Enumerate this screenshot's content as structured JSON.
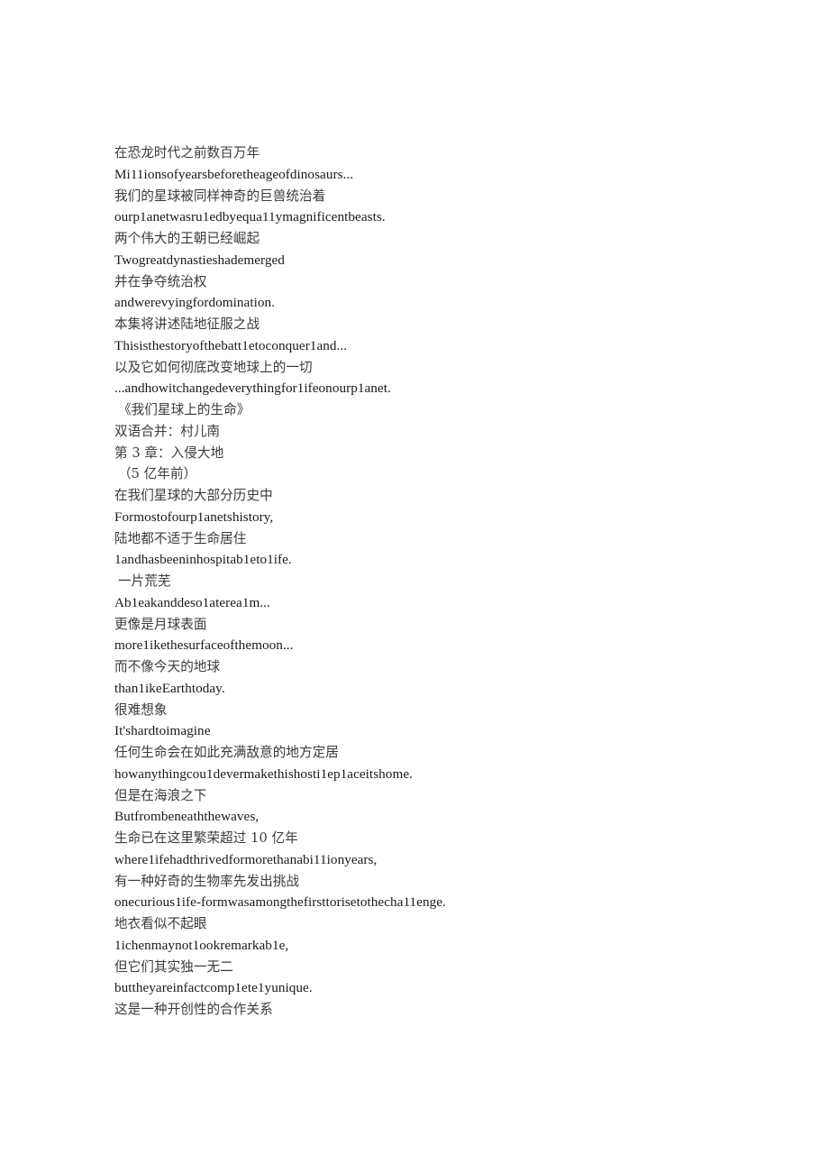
{
  "document": {
    "page_background": "#ffffff",
    "text_color_cjk": "#3a3a3a",
    "text_color_latin": "#1a1a1a",
    "lines": [
      {
        "id": "l01",
        "lang": "zh",
        "text": "在恐龙时代之前数百万年"
      },
      {
        "id": "l02",
        "lang": "en",
        "text": "Mi11ionsofyearsbeforetheageofdinosaurs..."
      },
      {
        "id": "l03",
        "lang": "zh",
        "text": "我们的星球被同样神奇的巨兽统治着"
      },
      {
        "id": "l04",
        "lang": "en",
        "text": "ourp1anetwasru1edbyequa11ymagnificentbeasts."
      },
      {
        "id": "l05",
        "lang": "zh",
        "text": "两个伟大的王朝已经崛起"
      },
      {
        "id": "l06",
        "lang": "en",
        "text": "Twogreatdynastieshademerged"
      },
      {
        "id": "l07",
        "lang": "zh",
        "text": "并在争夺统治权"
      },
      {
        "id": "l08",
        "lang": "en",
        "text": "andwerevyingfordomination."
      },
      {
        "id": "l09",
        "lang": "zh",
        "text": "本集将讲述陆地征服之战"
      },
      {
        "id": "l10",
        "lang": "en",
        "text": "Thisisthestoryofthebatt1etoconquer1and..."
      },
      {
        "id": "l11",
        "lang": "zh",
        "text": "以及它如何彻底改变地球上的一切"
      },
      {
        "id": "l12",
        "lang": "en",
        "text": "...andhowitchangedeverythingfor1ifeonourp1anet."
      },
      {
        "id": "l13",
        "lang": "zh",
        "text": "《我们星球上的生命》",
        "indent": true
      },
      {
        "id": "l14",
        "lang": "zh",
        "text": "双语合并：村儿南"
      },
      {
        "id": "l15",
        "lang": "zh",
        "text": "第 3 章：入侵大地"
      },
      {
        "id": "l16",
        "lang": "zh",
        "text": "（5 亿年前）",
        "indent": true
      },
      {
        "id": "l17",
        "lang": "zh",
        "text": "在我们星球的大部分历史中"
      },
      {
        "id": "l18",
        "lang": "en",
        "text": "Formostofourp1anetshistory,"
      },
      {
        "id": "l19",
        "lang": "zh",
        "text": "陆地都不适于生命居住"
      },
      {
        "id": "l20",
        "lang": "en",
        "text": "1andhasbeeninhospitab1eto1ife."
      },
      {
        "id": "l21",
        "lang": "zh",
        "text": "一片荒芜",
        "indent": true
      },
      {
        "id": "l22",
        "lang": "en",
        "text": "Ab1eakanddeso1aterea1m..."
      },
      {
        "id": "l23",
        "lang": "zh",
        "text": "更像是月球表面"
      },
      {
        "id": "l24",
        "lang": "en",
        "text": "more1ikethesurfaceofthemoon..."
      },
      {
        "id": "l25",
        "lang": "zh",
        "text": "而不像今天的地球"
      },
      {
        "id": "l26",
        "lang": "en",
        "text": "than1ikeEarthtoday."
      },
      {
        "id": "l27",
        "lang": "zh",
        "text": "很难想象"
      },
      {
        "id": "l28",
        "lang": "en",
        "text": "It'shardtoimagine"
      },
      {
        "id": "l29",
        "lang": "zh",
        "text": "任何生命会在如此充满敌意的地方定居"
      },
      {
        "id": "l30",
        "lang": "en",
        "text": "howanythingcou1devermakethishosti1ep1aceitshome."
      },
      {
        "id": "l31",
        "lang": "zh",
        "text": "但是在海浪之下"
      },
      {
        "id": "l32",
        "lang": "en",
        "text": "Butfrombeneaththewaves,"
      },
      {
        "id": "l33",
        "lang": "zh",
        "text": "生命已在这里繁荣超过 10 亿年"
      },
      {
        "id": "l34",
        "lang": "en",
        "text": "where1ifehadthrivedformorethanabi11ionyears,"
      },
      {
        "id": "l35",
        "lang": "zh",
        "text": "有一种好奇的生物率先发出挑战"
      },
      {
        "id": "l36",
        "lang": "en",
        "text": "onecurious1ife-formwasamongthefirsttorisetothecha11enge."
      },
      {
        "id": "l37",
        "lang": "zh",
        "text": "地衣看似不起眼"
      },
      {
        "id": "l38",
        "lang": "en",
        "text": "1ichenmaynot1ookremarkab1e,"
      },
      {
        "id": "l39",
        "lang": "zh",
        "text": "但它们其实独一无二"
      },
      {
        "id": "l40",
        "lang": "en",
        "text": "buttheyareinfactcomp1ete1yunique."
      },
      {
        "id": "l41",
        "lang": "zh",
        "text": "这是一种开创性的合作关系"
      }
    ]
  }
}
